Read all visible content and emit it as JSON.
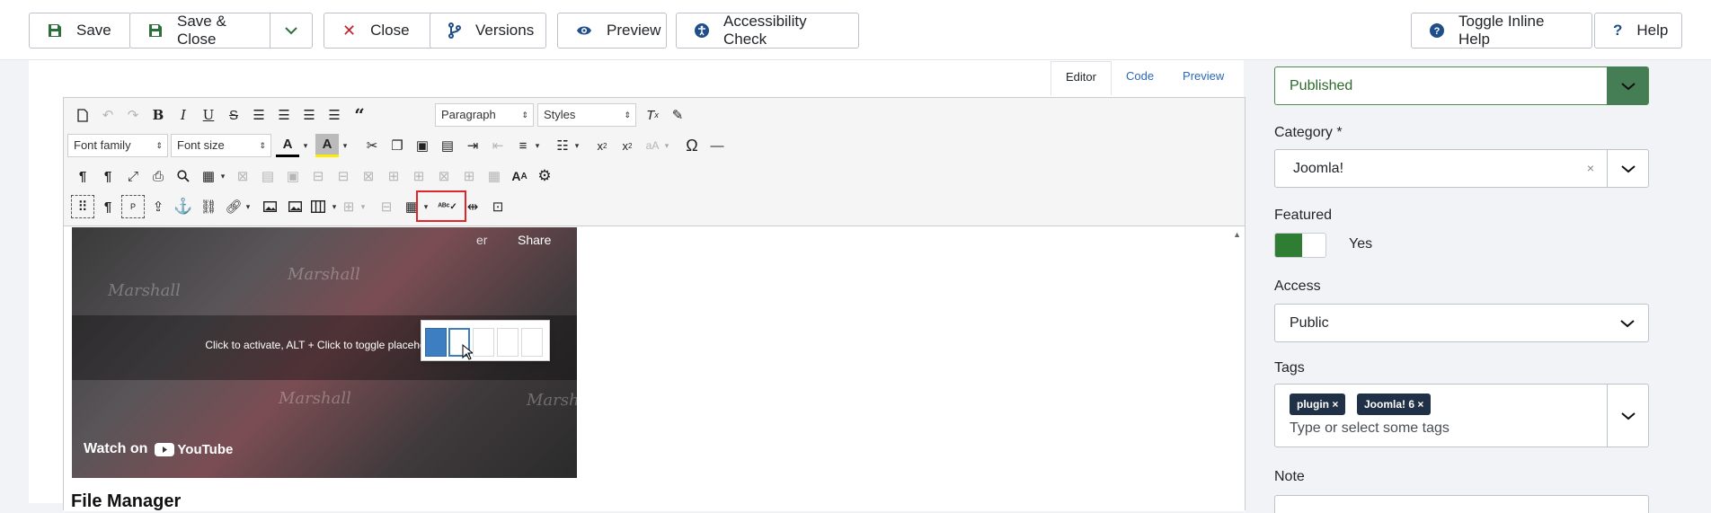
{
  "toolbar": {
    "save": "Save",
    "save_close": "Save & Close",
    "close": "Close",
    "versions": "Versions",
    "preview": "Preview",
    "accessibility": "Accessibility Check",
    "inline_help": "Toggle Inline Help",
    "help": "Help"
  },
  "editor_tabs": [
    "Editor",
    "Code",
    "Preview"
  ],
  "editor": {
    "format_select": "Paragraph",
    "styles_select": "Styles",
    "font_family": "Font family",
    "font_size": "Font size",
    "video_message": "Click to activate, ALT + Click to toggle placeholder",
    "video_watch": "Watch on",
    "video_brand": "YouTube",
    "video_share": "Share",
    "video_partial": "er",
    "video_watermark": "Marshall",
    "heading": "File Manager"
  },
  "column_popup": {
    "selected": 1,
    "hovered": 2,
    "total": 5
  },
  "sidebar": {
    "status": "Published",
    "category_label": "Category *",
    "category_value": "Joomla!",
    "featured_label": "Featured",
    "featured_value": "Yes",
    "access_label": "Access",
    "access_value": "Public",
    "tags_label": "Tags",
    "tags": [
      "plugin",
      "Joomla! 6"
    ],
    "tags_placeholder": "Type or select some tags",
    "note_label": "Note"
  },
  "colors": {
    "accent": "#2a69b8",
    "published": "#457d54",
    "toggle_on": "#2f7d32",
    "highlight": "#e0262a"
  }
}
